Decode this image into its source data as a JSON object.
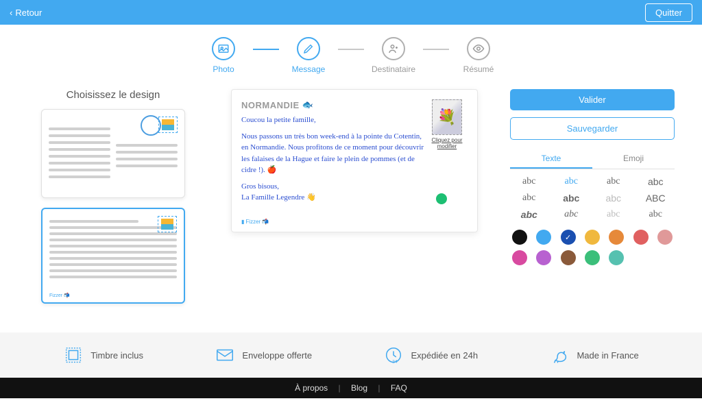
{
  "topbar": {
    "back": "Retour",
    "quit": "Quitter"
  },
  "steps": {
    "photo": "Photo",
    "message": "Message",
    "destinataire": "Destinataire",
    "resume": "Résumé"
  },
  "design": {
    "title": "Choisissez le design",
    "fizzer": "Fizzer 📬"
  },
  "postcard": {
    "title": "NORMANDIE",
    "titleEmoji": "🐟",
    "body1": "Coucou la petite famille,",
    "body2": "Nous passons un très bon week-end à la pointe du Cotentin, en Normandie. Nous profitons de ce moment pour découvrir les falaises de la Hague et faire le plein de pommes (et de cidre !). 🍎",
    "body3": "Gros bisous,",
    "body4": "La Famille Legendre 👋",
    "stampCaption": "Cliquez pour modifier",
    "signature": "Fizzer 📬"
  },
  "actions": {
    "validate": "Valider",
    "save": "Sauvegarder"
  },
  "tabs": {
    "texte": "Texte",
    "emoji": "Emoji"
  },
  "fontSample": "abc",
  "fontSampleCaps": "ABC",
  "colors": {
    "row1": [
      "#111111",
      "#42a9f0",
      "#1a4fb0",
      "#f0b83e",
      "#e6893a",
      "#e06060",
      "#e09999"
    ],
    "row2": [
      "#d84aa0",
      "#b861d0",
      "#8a5a3a",
      "#3bbf7a",
      "#56c1b0",
      "",
      ""
    ],
    "selectedIndex": 2
  },
  "features": {
    "stamp": "Timbre inclus",
    "envelope": "Enveloppe offerte",
    "ship": "Expédiée en 24h",
    "france": "Made in France"
  },
  "footer": {
    "about": "À propos",
    "blog": "Blog",
    "faq": "FAQ"
  }
}
